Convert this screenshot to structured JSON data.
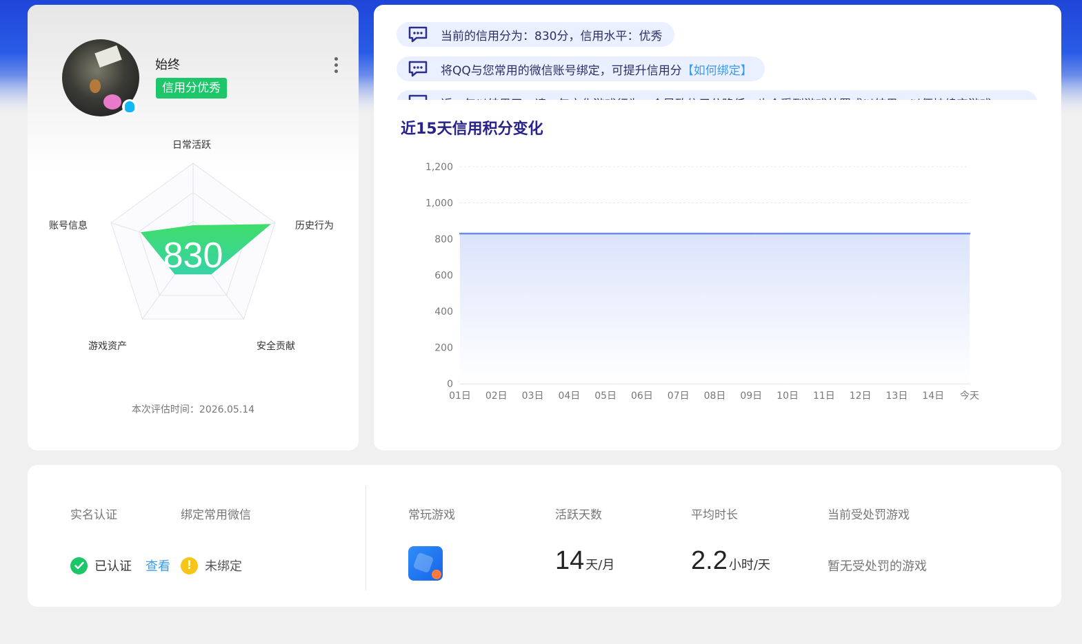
{
  "profile": {
    "nickname": "始终",
    "credit_tag": "信用分优秀",
    "score": "830",
    "radar_labels": {
      "top": "日常活跃",
      "right": "历史行为",
      "bottom_right": "安全贡献",
      "bottom_left": "游戏资产",
      "left": "账号信息"
    },
    "radar_values": [
      0.28,
      0.95,
      0.36,
      0.36,
      0.64
    ],
    "eval_time": "本次评估时间：2026.05.14"
  },
  "notices": [
    {
      "text": "当前的信用分为：830分，信用水平：优秀",
      "link": ""
    },
    {
      "text": "将QQ与您常用的微信账号绑定，可提升信用分",
      "link": "【如何绑定】"
    },
    {
      "text": "近一年以结果了，请一年文化游戏行为，会导致信用分降低，也会受到游戏处罚或以结果，以便持续守游戏",
      "link": ""
    }
  ],
  "chart_title": "近15天信用积分变化",
  "chart_data": {
    "type": "area",
    "title": "近15天信用积分变化",
    "categories": [
      "01日",
      "02日",
      "03日",
      "04日",
      "05日",
      "06日",
      "07日",
      "08日",
      "09日",
      "10日",
      "11日",
      "12日",
      "13日",
      "14日",
      "今天"
    ],
    "values": [
      830,
      830,
      830,
      830,
      830,
      830,
      830,
      830,
      830,
      830,
      830,
      830,
      830,
      830,
      830
    ],
    "yticks": [
      "0",
      "200",
      "400",
      "600",
      "800",
      "1,000",
      "1,200"
    ],
    "ylim": [
      0,
      1200
    ],
    "xlabel": "",
    "ylabel": "",
    "grid": true,
    "line_color": "#6a8cf0"
  },
  "bottom": {
    "labels": {
      "realname": "实名认证",
      "wechat": "绑定常用微信",
      "games": "常玩游戏",
      "active_days": "活跃天数",
      "avg_time": "平均时长",
      "penalty": "当前受处罚游戏"
    },
    "realname_status": "已认证",
    "view_link": "查看",
    "wechat_status": "未绑定",
    "active_days_value": "14",
    "active_days_unit": "天/月",
    "avg_time_value": "2.2",
    "avg_time_unit": "小时/天",
    "penalty_text": "暂无受处罚的游戏"
  },
  "colors": {
    "brand_blue": "#2a5ce6",
    "success_green": "#1dc769",
    "warning_yellow": "#f5c518",
    "link_blue": "#3a9bf0",
    "title_indigo": "#28238a"
  }
}
